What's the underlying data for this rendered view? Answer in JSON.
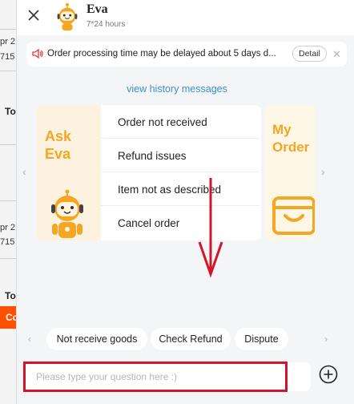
{
  "background_page": {
    "text_1a": "pr 2",
    "text_1b": "715",
    "text_2a": "pr 2",
    "text_2b": "715",
    "bold_1": "To",
    "bold_2": "To",
    "button_fragment": "Co"
  },
  "header": {
    "agent_name": "Eva",
    "agent_hours": "7*24 hours",
    "close_icon": "close-icon",
    "avatar_icon": "robot-avatar-icon"
  },
  "notice": {
    "text": "Order processing time may be delayed about 5 days d...",
    "detail_label": "Detail",
    "speaker_icon": "speaker-icon",
    "close_icon": "close-icon"
  },
  "history_link": "view history messages",
  "ask_card": {
    "title_line1": "Ask",
    "title_line2": "Eva",
    "items": [
      {
        "label": "Order not received"
      },
      {
        "label": "Refund issues"
      },
      {
        "label": "Item not as described"
      },
      {
        "label": "Cancel order"
      }
    ]
  },
  "order_card": {
    "title_line1": "My",
    "title_line2": "Order",
    "icon": "shopping-bag-icon"
  },
  "quick_replies": [
    {
      "label": "Not receive goods"
    },
    {
      "label": "Check Refund"
    },
    {
      "label": "Dispute"
    }
  ],
  "input": {
    "placeholder": "Please type your question here :)",
    "value": ""
  },
  "colors": {
    "accent_orange": "#f5a623",
    "link_blue": "#3f8fd2",
    "annotation_red": "#d3152b",
    "page_orange": "#ff5000"
  }
}
